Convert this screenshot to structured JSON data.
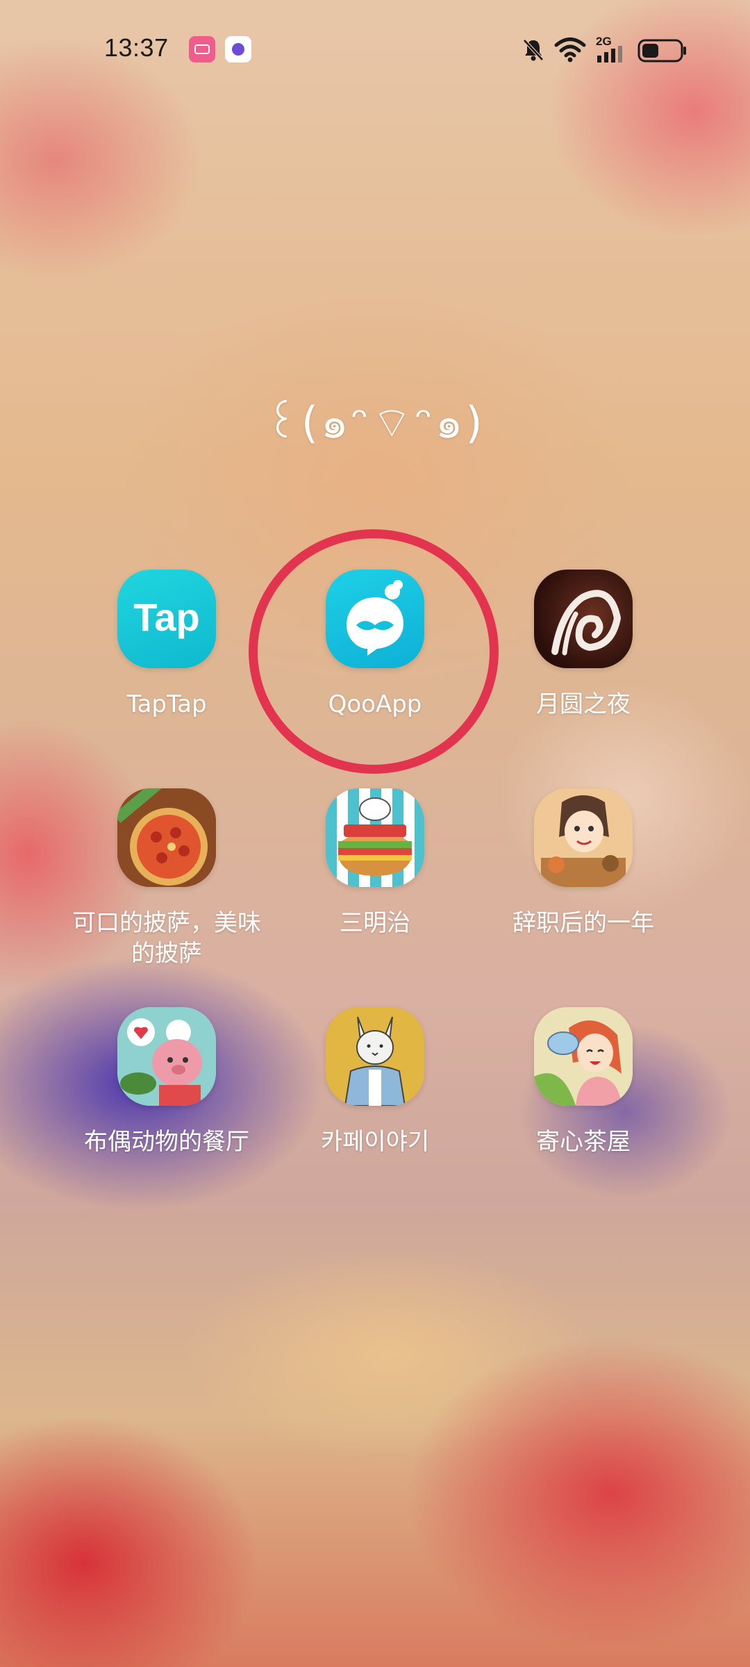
{
  "status_bar": {
    "time": "13:37",
    "notification_icons": [
      "bilibili-comic-icon",
      "message-app-icon"
    ],
    "system_icons": [
      "bell-muted-icon",
      "wifi-icon",
      "cellular-signal-icon",
      "battery-icon"
    ],
    "network_label": "2G",
    "battery_level": 0.45
  },
  "folder": {
    "title": "꒰(๑ᵔ⌔ᵔ๑)",
    "apps": [
      {
        "label": "TapTap",
        "icon": "taptap-icon",
        "color": "#18c8d8"
      },
      {
        "label": "QooApp",
        "icon": "qooapp-mustache-icon",
        "color": "#16bfdc",
        "highlighted": true
      },
      {
        "label": "月圆之夜",
        "icon": "moon-night-icon",
        "color": "#3a1a14"
      },
      {
        "label": "可口的披萨，美味的披萨",
        "icon": "pizza-game-icon",
        "color": "#b86d3c"
      },
      {
        "label": "三明治",
        "icon": "sandwich-game-icon",
        "color": "#3bb5c8"
      },
      {
        "label": "辞职后的一年",
        "icon": "resignation-year-icon",
        "color": "#e8b070"
      },
      {
        "label": "布偶动物的餐厅",
        "icon": "doll-restaurant-icon",
        "color": "#79c7c6"
      },
      {
        "label": "카페이야기",
        "icon": "cafe-story-cat-icon",
        "color": "#e0b341"
      },
      {
        "label": "寄心茶屋",
        "icon": "tea-house-girl-icon",
        "color": "#e6ddb0"
      }
    ]
  },
  "highlight": {
    "color": "#e2344e"
  }
}
